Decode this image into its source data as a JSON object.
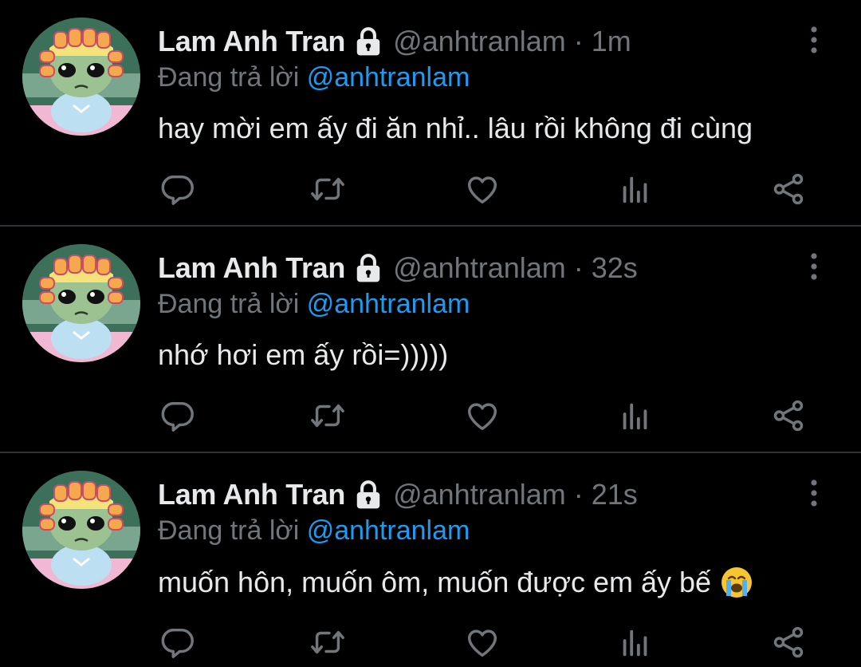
{
  "tweets": [
    {
      "name": "Lam Anh Tran",
      "handle": "@anhtranlam",
      "separator": "·",
      "time": "1m",
      "reply_prefix": "Đang trả lời",
      "reply_mention": "@anhtranlam",
      "text": "hay mời em ấy đi ăn nhỉ.. lâu rồi không đi cùng",
      "emoji": ""
    },
    {
      "name": "Lam Anh Tran",
      "handle": "@anhtranlam",
      "separator": "·",
      "time": "32s",
      "reply_prefix": "Đang trả lời",
      "reply_mention": "@anhtranlam",
      "text": "nhớ hơi em ấy rồi=)))))",
      "emoji": ""
    },
    {
      "name": "Lam Anh Tran",
      "handle": "@anhtranlam",
      "separator": "·",
      "time": "21s",
      "reply_prefix": "Đang trả lời",
      "reply_mention": "@anhtranlam",
      "text": "muốn hôn, muốn ôm, muốn được em ấy bế",
      "emoji": "loudly-crying-face-emoji"
    }
  ],
  "icons": {
    "protected": "lock-icon",
    "more": "more-vertical-icon",
    "reply": "reply-icon",
    "retweet": "retweet-icon",
    "like": "heart-icon",
    "views": "analytics-icon",
    "share": "share-icon"
  },
  "colors": {
    "background": "#000000",
    "text": "#e7e9ea",
    "muted": "#71767b",
    "accent": "#1d9bf0",
    "divider": "#2f3336"
  }
}
